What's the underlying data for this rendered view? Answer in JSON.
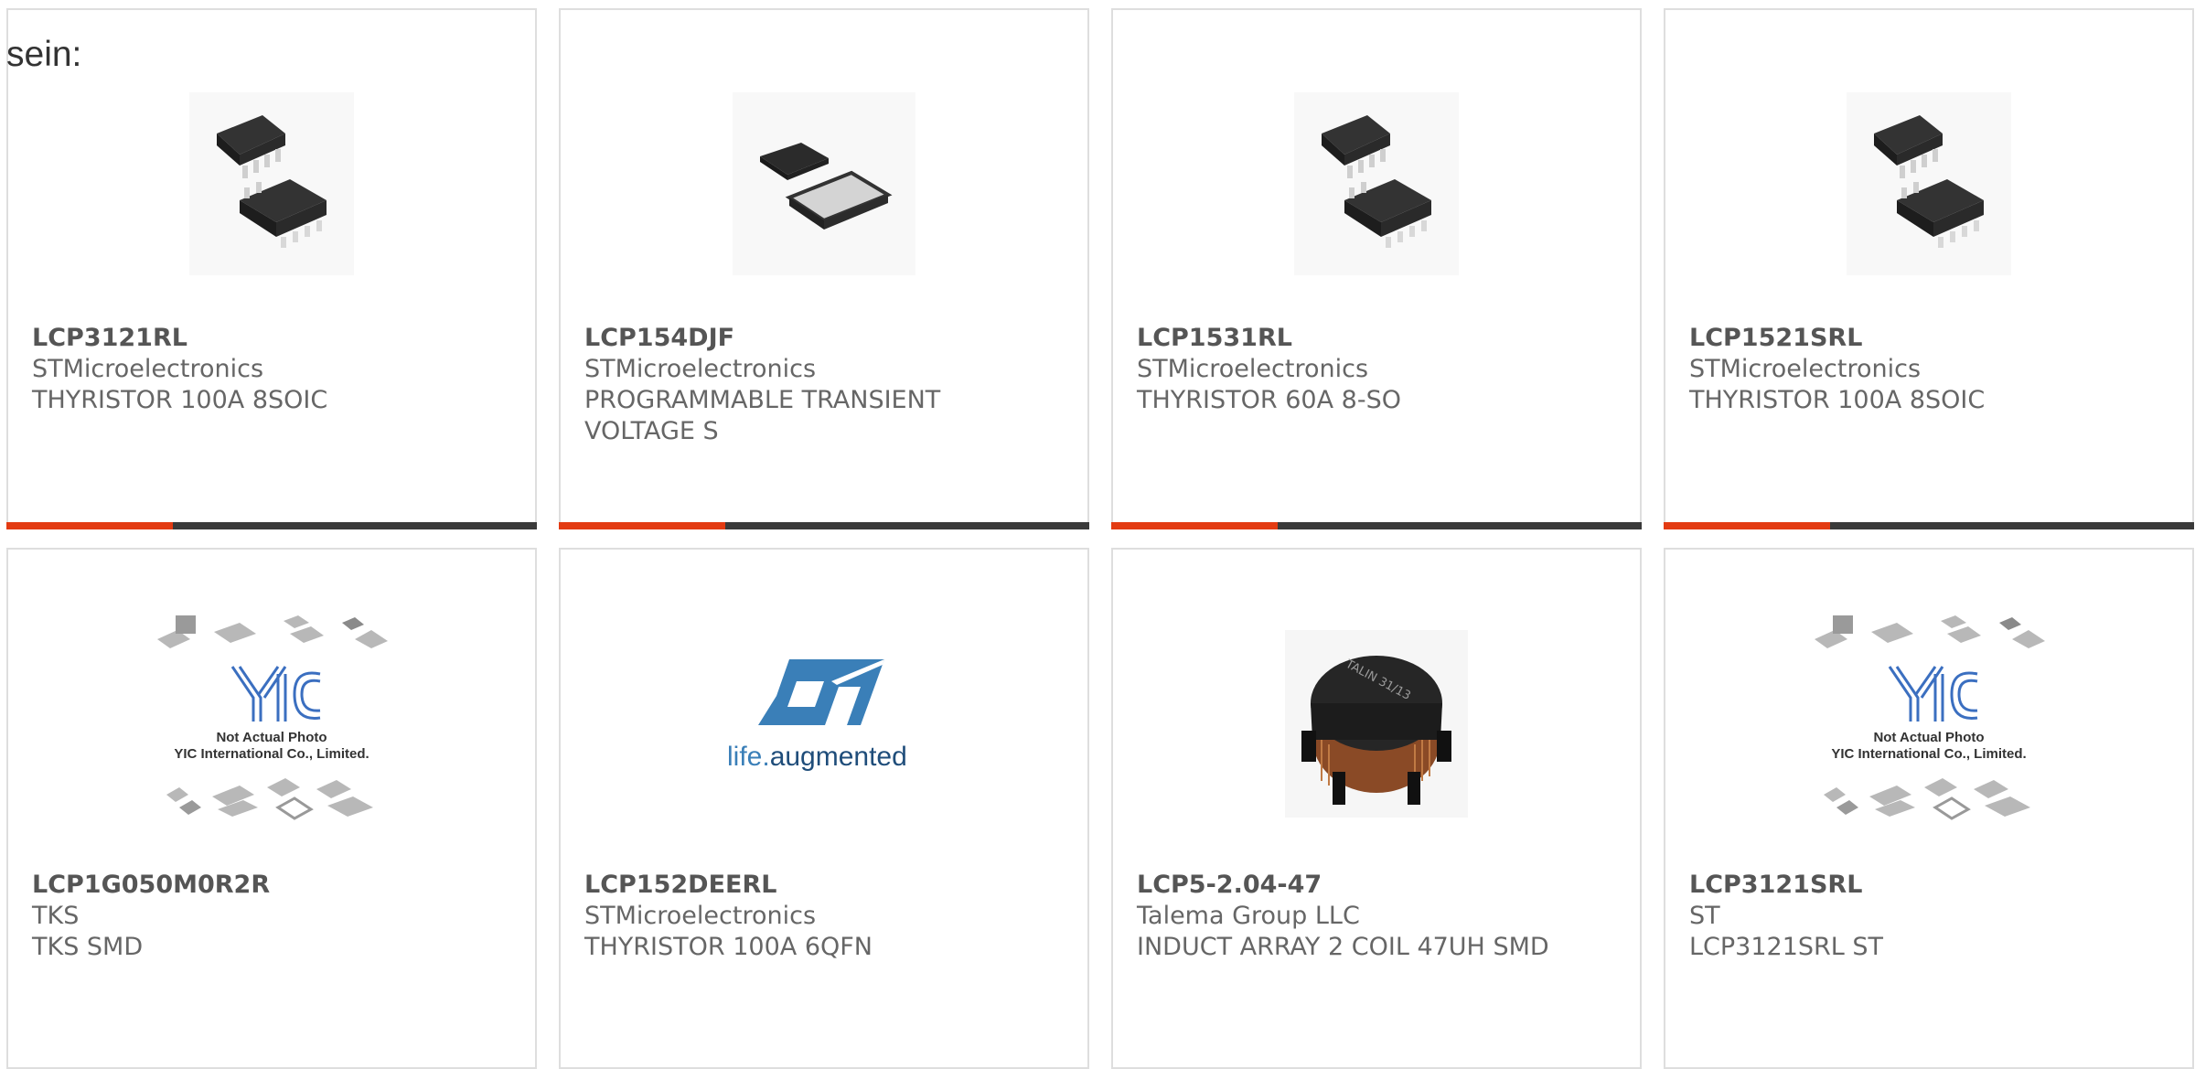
{
  "lead_text": "sein:",
  "products": [
    {
      "part": "LCP3121RL",
      "maker": "STMicroelectronics",
      "desc": "THYRISTOR 100A 8SOIC",
      "image": "soic-8-chip-photo"
    },
    {
      "part": "LCP154DJF",
      "maker": "STMicroelectronics",
      "desc": "PROGRAMMABLE TRANSIENT VOLTAGE S",
      "image": "qfn-chip-photo"
    },
    {
      "part": "LCP1531RL",
      "maker": "STMicroelectronics",
      "desc": "THYRISTOR 60A 8-SO",
      "image": "soic-8-chip-photo"
    },
    {
      "part": "LCP1521SRL",
      "maker": "STMicroelectronics",
      "desc": "THYRISTOR 100A 8SOIC",
      "image": "soic-8-chip-photo"
    },
    {
      "part": "LCP1G050M0R2R",
      "maker": "TKS",
      "desc": "TKS SMD",
      "image": "yic-placeholder",
      "placeholder_line1": "Not Actual Photo",
      "placeholder_line2": "YIC International Co., Limited."
    },
    {
      "part": "LCP152DEERL",
      "maker": "STMicroelectronics",
      "desc": "THYRISTOR 100A 6QFN",
      "image": "st-logo",
      "logo_tagline_a": "life.",
      "logo_tagline_b": "augmented"
    },
    {
      "part": "LCP5-2.04-47",
      "maker": "Talema Group LLC",
      "desc": "INDUCT ARRAY 2 COIL 47UH SMD",
      "image": "inductor-photo",
      "inductor_marking": "TALIN 31/13"
    },
    {
      "part": "LCP3121SRL",
      "maker": "ST",
      "desc": "LCP3121SRL ST",
      "image": "yic-placeholder",
      "placeholder_line1": "Not Actual Photo",
      "placeholder_line2": "YIC International Co., Limited."
    }
  ],
  "colors": {
    "accent": "#e33b12",
    "bar": "#3a3a3a",
    "border": "#dedede"
  }
}
